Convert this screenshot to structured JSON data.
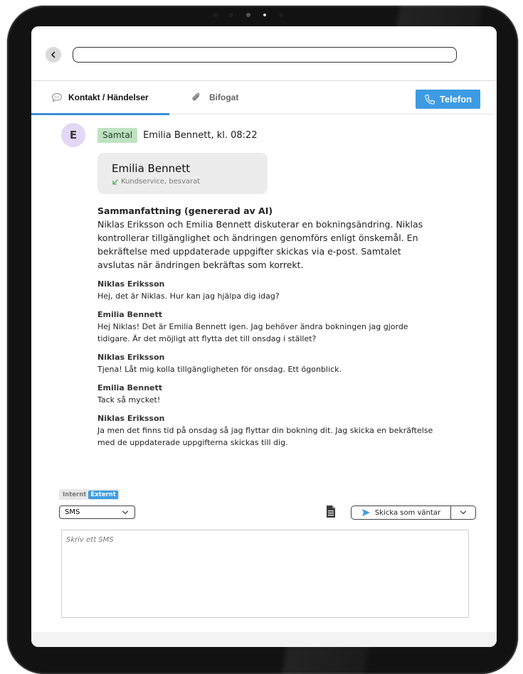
{
  "address_bar": {
    "value": ""
  },
  "tabs": [
    {
      "label": "Kontakt / Händelser",
      "icon": "speech-bubble-icon",
      "active": true
    },
    {
      "label": "Bifogat",
      "icon": "paperclip-icon",
      "active": false
    }
  ],
  "phone_button": {
    "label": "Telefon",
    "icon": "phone-icon"
  },
  "event": {
    "avatar_letter": "E",
    "badge": "Samtal",
    "title": "Emilia Bennett, kl. 08:22",
    "call_card": {
      "name": "Emilia Bennett",
      "status": "Kundservice, besvarat",
      "icon": "arrow-down-left-icon"
    }
  },
  "summary": {
    "title": "Sammanfattning (genererad av AI)",
    "text": "Niklas Eriksson och Emilia Bennett diskuterar en bokningsändring. Niklas kontrollerar tillgänglighet och ändringen genomförs enligt önskemål. En bekräftelse med uppdaterade uppgifter skickas via e-post. Samtalet avslutas när ändringen bekräftas som korrekt."
  },
  "transcript": [
    {
      "author": "Niklas Eriksson",
      "text": "Hej, det är Niklas. Hur kan jag hjälpa dig idag?"
    },
    {
      "author": "Emilia Bennett",
      "text": "Hej Niklas! Det är Emilia Bennett igen. Jag behöver ändra bokningen jag gjorde tidigare. Är det möjligt att flytta det till onsdag i stället?"
    },
    {
      "author": "Niklas Eriksson",
      "text": "Tjena! Låt mig kolla tillgängligheten för onsdag. Ett ögonblick."
    },
    {
      "author": "Emilia Bennett",
      "text": "Tack så mycket!"
    },
    {
      "author": "Niklas Eriksson",
      "text": "Ja men det finns tid på onsdag så jag flyttar din bokning dit. Jag skicka en bekräftelse med de uppdaterade uppgifterna skickas till dig."
    }
  ],
  "composer": {
    "toggle": {
      "internal": "Internt",
      "external": "Externt",
      "selected": "Externt"
    },
    "channel": "SMS",
    "send_label": "Skicka som väntar",
    "placeholder": "Skriv ett SMS"
  },
  "colors": {
    "accent": "#3d9be3",
    "badge_bg": "#bfe3c2",
    "avatar_bg": "#e3d7f5"
  }
}
